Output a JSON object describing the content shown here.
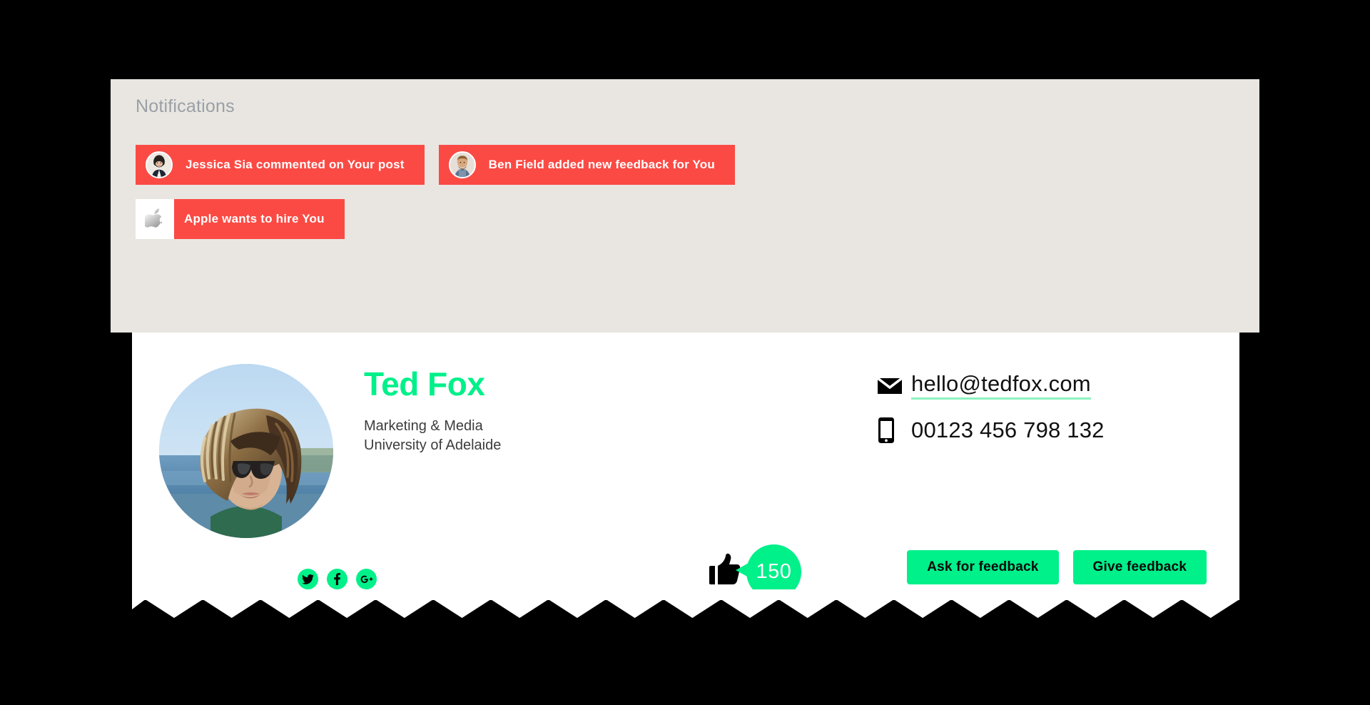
{
  "theme": {
    "page_bg": "#000000",
    "panel_bg": "#E9E6E1",
    "card_bg": "#FFFFFF",
    "accent_green": "#00F08A",
    "accent_red": "#FB4A44",
    "underline_green": "#8BF3BF",
    "muted_text": "#9AA0A6"
  },
  "notifications": {
    "title": "Notifications",
    "items": [
      {
        "text": "Jessica Sia commented on Your post",
        "avatar": "woman-avatar",
        "style": "pill-with-avatar"
      },
      {
        "text": "Ben Field added new feedback for You",
        "avatar": "man-avatar",
        "style": "pill-with-avatar"
      },
      {
        "text": "Apple wants to hire You",
        "avatar": "apple-logo-icon",
        "style": "tile-plus-pill"
      }
    ]
  },
  "profile": {
    "avatar": "profile-photo",
    "name": "Ted Fox",
    "role": "Marketing & Media",
    "organisation": "University of Adelaide",
    "contact": {
      "email_icon": "envelope-icon",
      "email": "hello@tedfox.com",
      "phone_icon": "mobile-phone-icon",
      "phone": "00123 456 798 132"
    },
    "socials": [
      {
        "name": "twitter-icon",
        "label": "Twitter"
      },
      {
        "name": "facebook-icon",
        "label": "Facebook"
      },
      {
        "name": "google-plus-icon",
        "label": "Google Plus"
      }
    ],
    "likes": {
      "icon": "thumbs-up-icon",
      "count": "150"
    },
    "actions": [
      {
        "label": "Ask for feedback"
      },
      {
        "label": "Give feedback"
      }
    ]
  }
}
